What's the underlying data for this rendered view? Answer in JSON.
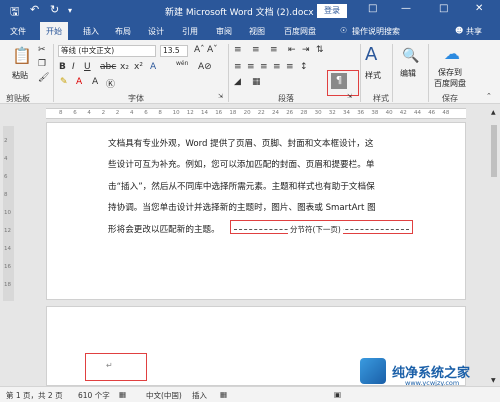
{
  "titlebar": {
    "title": "新建 Microsoft Word 文档 (2).docx - Word",
    "login": "登录",
    "save_icon": "save-icon",
    "undo_icon": "undo-icon",
    "redo_icon": "redo-icon"
  },
  "tabs": [
    "文件",
    "开始",
    "插入",
    "布局",
    "设计",
    "引用",
    "审阅",
    "视图",
    "百度网盘",
    "操作说明搜索"
  ],
  "share": "共享",
  "ribbon": {
    "paste": "粘贴",
    "font_name": "等线 (中文正文)",
    "font_size": "13.5",
    "wen": "wén",
    "styles": "样式",
    "edit": "编辑",
    "save_to": "保存到",
    "baidu": "百度网盘",
    "groups": {
      "clipboard": "剪贴板",
      "font": "字体",
      "paragraph": "段落",
      "styles": "样式",
      "save": "保存"
    }
  },
  "ruler": {
    "top_numbers": [
      "8",
      "6",
      "4",
      "2",
      "2",
      "4",
      "6",
      "8",
      "10",
      "12",
      "14",
      "16",
      "18",
      "20",
      "22",
      "24",
      "26",
      "28",
      "30",
      "32",
      "34",
      "36",
      "38",
      "40",
      "42",
      "44",
      "46",
      "48"
    ],
    "left_numbers": [
      "2",
      "4",
      "6",
      "8",
      "10",
      "12",
      "14",
      "16",
      "18"
    ]
  },
  "document": {
    "lines": [
      "文档具有专业外观，Word 提供了页眉、页脚、封面和文本框设计，这",
      "些设计可互为补充。例如，您可以添加匹配的封面、页眉和提要栏。单",
      "击“插入”，然后从不同库中选择所需元素。主题和样式也有助于文档保",
      "持协调。当您单击设计并选择新的主题时，图片、图表或 SmartArt 图",
      "形将会更改以匹配新的主题。"
    ],
    "section_break": "分节符(下一页)",
    "paragraph_mark": "↵"
  },
  "status": {
    "page": "第 1 页，共 2 页",
    "words": "610 个字",
    "lang": "中文(中国)",
    "insert": "插入"
  },
  "watermark": {
    "text": "纯净系统之家",
    "url": "www.ycwjzy.com"
  },
  "colors": {
    "brand": "#2b579a",
    "highlight_box": "#e04040"
  }
}
